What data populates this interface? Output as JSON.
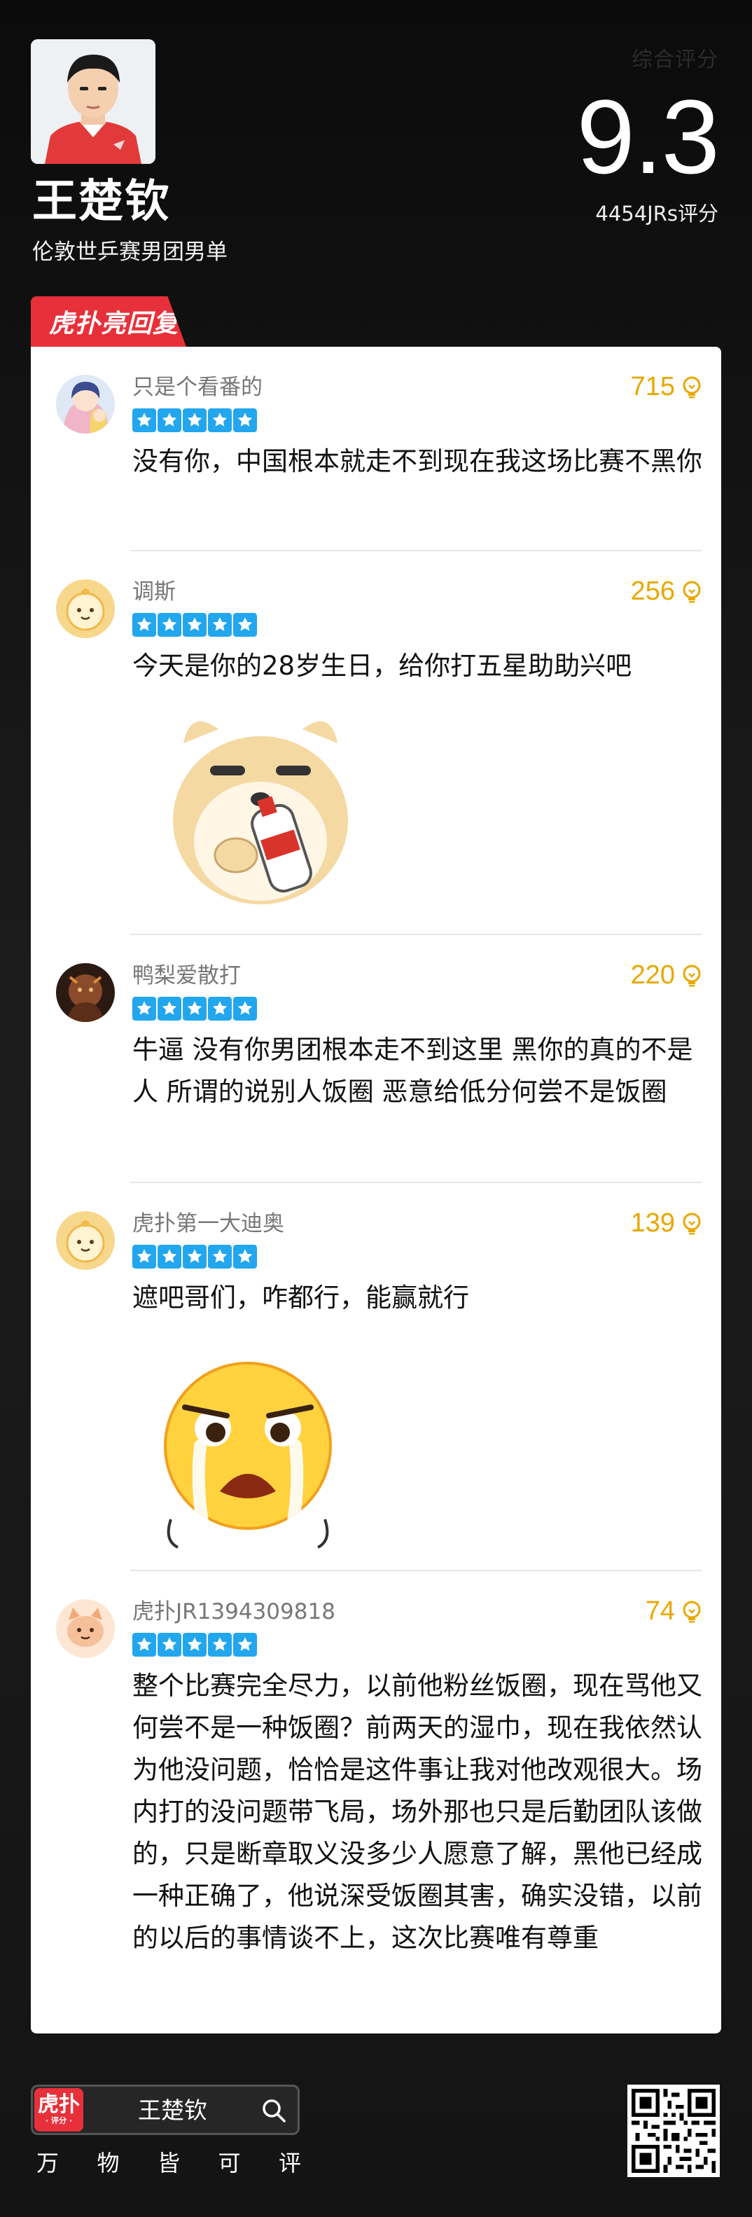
{
  "header": {
    "player_name": "王楚钦",
    "subtitle": "伦敦世乒赛男团男单",
    "score": "9.3",
    "rating_count": "4454JRs评分",
    "score_caption": "综合评分"
  },
  "section_tag": "虎扑亮回复",
  "comments": [
    {
      "user": "只是个看番的",
      "likes": "715",
      "rating": 5,
      "avatar": "anime-avatar",
      "text": "没有你，中国根本就走不到现在我这场比赛不黑你"
    },
    {
      "user": "调斯",
      "likes": "256",
      "rating": 5,
      "avatar": "default-avatar",
      "text": "今天是你的28岁生日，给你打五星助助兴吧",
      "sticker": "dog-holding-bottle-sticker"
    },
    {
      "user": "鸭梨爱散打",
      "likes": "220",
      "rating": 5,
      "avatar": "photo-avatar",
      "text": "牛逼 没有你男团根本走不到这里 黑你的真的不是人 所谓的说别人饭圈 恶意给低分何尝不是饭圈"
    },
    {
      "user": "虎扑第一大迪奥",
      "likes": "139",
      "rating": 5,
      "avatar": "default-avatar",
      "text": "遮吧哥们，咋都行，能赢就行",
      "sticker": "crying-emoji-sticker"
    },
    {
      "user": "虎扑JR1394309818",
      "likes": "74",
      "rating": 5,
      "avatar": "cat-avatar",
      "text": "整个比赛完全尽力，以前他粉丝饭圈，现在骂他又何尝不是一种饭圈？前两天的湿巾，现在我依然认为他没问题，恰恰是这件事让我对他改观很大。场内打的没问题带飞局，场外那也只是后勤团队该做的，只是断章取义没多少人愿意了解，黑他已经成一种正确了，他说深受饭圈其害，确实没错，以前的以后的事情谈不上，这次比赛唯有尊重"
    }
  ],
  "footer": {
    "logo_main": "虎扑",
    "logo_sub": "· 评分 ·",
    "search_text": "王楚钦",
    "slogan": [
      "万",
      "物",
      "皆",
      "可",
      "评"
    ]
  },
  "colors": {
    "accent_red": "#e8303a",
    "star_blue": "#22a6ee",
    "likes_gold": "#e8a800"
  }
}
